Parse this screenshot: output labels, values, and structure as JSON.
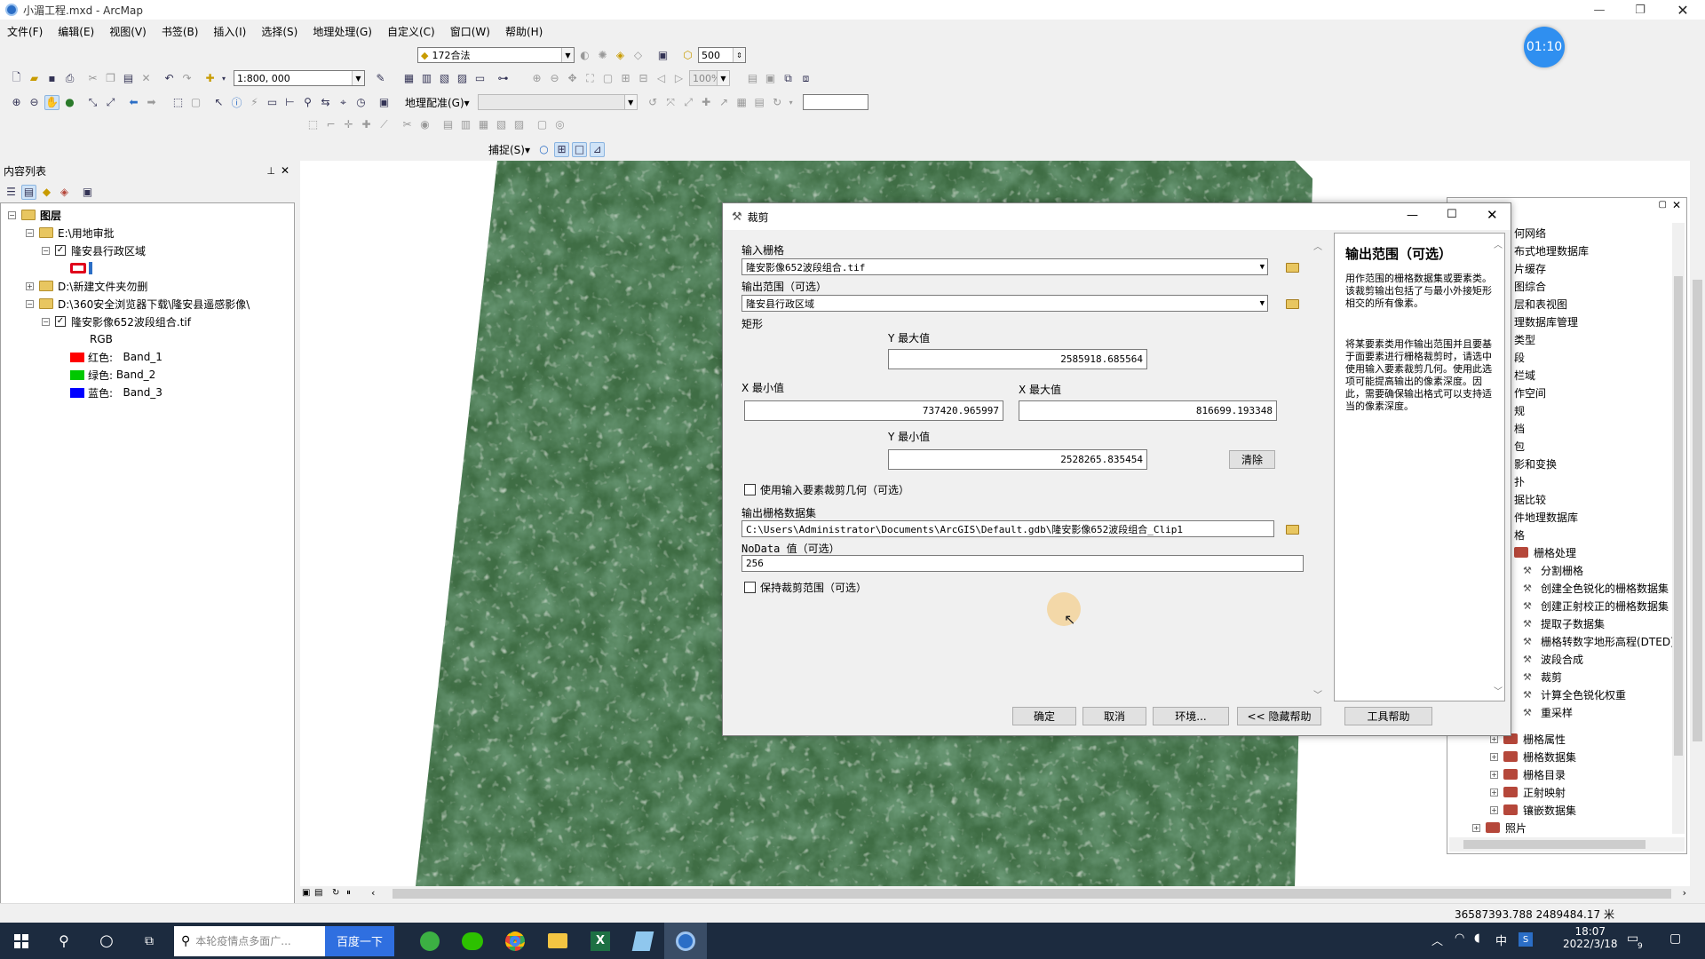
{
  "window": {
    "title": "小湄工程.mxd - ArcMap",
    "timer": "01:10"
  },
  "menu": [
    "文件(F)",
    "编辑(E)",
    "视图(V)",
    "书签(B)",
    "插入(I)",
    "选择(S)",
    "地理处理(G)",
    "自定义(C)",
    "窗口(W)",
    "帮助(H)"
  ],
  "toolbar": {
    "layer_combo": "172合法",
    "scale_num": "500",
    "scale": "1:800, 000",
    "zoom_pct": "100%",
    "georef_label": "地理配准(G)▾",
    "snapping_label": "捕捉(S)▾"
  },
  "toc": {
    "title": "内容列表",
    "root": "图层",
    "items": [
      {
        "label": "E:\\用地审批",
        "type": "folder"
      },
      {
        "label": "隆安县行政区域",
        "type": "layer",
        "checked": true
      },
      {
        "label": "D:\\新建文件夹勿删",
        "type": "folder"
      },
      {
        "label": "D:\\360安全浏览器下载\\隆安县遥感影像\\",
        "type": "folder"
      },
      {
        "label": "隆安影像652波段组合.tif",
        "type": "layer",
        "checked": true
      }
    ],
    "rgb_label": "RGB",
    "bands": [
      {
        "prefix": "红色:",
        "band": "Band_1",
        "color": "#ff0000"
      },
      {
        "prefix": "绿色:",
        "band": "Band_2",
        "color": "#00c800"
      },
      {
        "prefix": "蓝色:",
        "band": "Band_3",
        "color": "#0000ff"
      }
    ]
  },
  "dialog": {
    "title": "裁剪",
    "input_raster_label": "输入栅格",
    "input_raster": "隆安影像652波段组合.tif",
    "extent_label": "输出范围（可选）",
    "extent": "隆安县行政区域",
    "rect_label": "矩形",
    "ymax_label": "Y 最大值",
    "ymax": "2585918.685564",
    "xmin_label": "X 最小值",
    "xmin": "737420.965997",
    "xmax_label": "X 最大值",
    "xmax": "816699.193348",
    "ymin_label": "Y 最小值",
    "ymin": "2528265.835454",
    "clear_btn": "清除",
    "use_geom_label": "使用输入要素裁剪几何（可选）",
    "output_label": "输出栅格数据集",
    "output": "C:\\Users\\Administrator\\Documents\\ArcGIS\\Default.gdb\\隆安影像652波段组合_Clip1",
    "nodata_label": "NoData 值（可选）",
    "nodata": "256",
    "maintain_label": "保持裁剪范围（可选）",
    "buttons": {
      "ok": "确定",
      "cancel": "取消",
      "env": "环境...",
      "hide_help": "<< 隐藏帮助",
      "tool_help": "工具帮助"
    }
  },
  "help": {
    "title": "输出范围（可选）",
    "p1": "用作范围的栅格数据集或要素类。该裁剪输出包括了与最小外接矩形相交的所有像素。",
    "p2": "将某要素类用作输出范围并且要基于面要素进行栅格裁剪时，请选中使用输入要素裁剪几何。使用此选项可能提高输出的像素深度。因此，需要确保输出格式可以支持适当的像素深度。"
  },
  "toolbox": {
    "partial_items": [
      "何网络",
      "布式地理数据库",
      "片缓存",
      "图综合",
      "层和表视图",
      "理数据库管理",
      "类型",
      "段",
      "栏域",
      "作空间",
      "规",
      "档",
      "包",
      "影和变换",
      "扑",
      "据比较",
      "件地理数据库",
      "格"
    ],
    "raster_processing": "栅格处理",
    "tools": [
      "分割栅格",
      "创建全色锐化的栅格数据集",
      "创建正射校正的栅格数据集",
      "提取子数据集",
      "栅格转数字地形高程(DTED)",
      "波段合成",
      "裁剪",
      "计算全色锐化权重",
      "重采样"
    ],
    "toolsets": [
      "栅格属性",
      "栅格数据集",
      "栅格目录",
      "正射映射",
      "镶嵌数据集"
    ],
    "last": "照片"
  },
  "status": {
    "coords": "36587393.788  2489484.17 米"
  },
  "taskbar": {
    "search_placeholder": "本轮疫情点多面广...",
    "search_button": "百度一下",
    "time": "18:07",
    "date": "2022/3/18",
    "ime": "中",
    "notif": "9"
  }
}
